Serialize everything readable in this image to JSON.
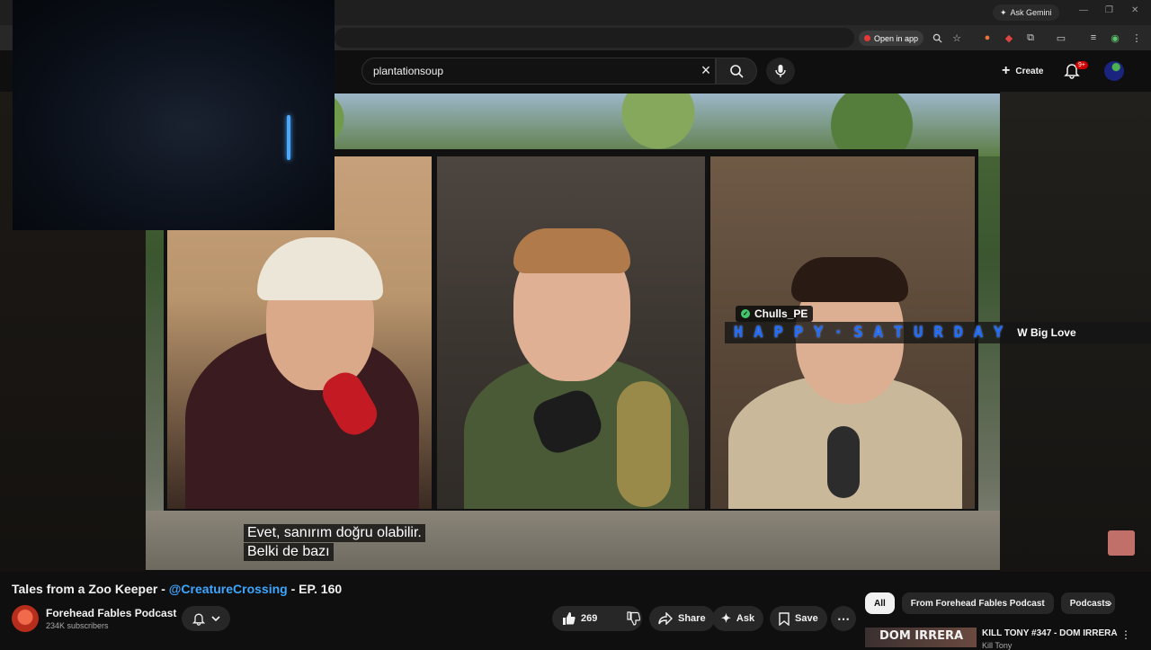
{
  "browser": {
    "ask_gemini": "Ask Gemini",
    "open_in_app": "Open in app",
    "window_min": "—",
    "window_restore": "❐",
    "window_close": "✕"
  },
  "header": {
    "search_value": "plantationsoup",
    "create_label": "Create",
    "notif_badge": "9+"
  },
  "video": {
    "chat_username": "Chulls_PE",
    "chat_message": "HAPPY·SATURDAY",
    "chat_tail": "W Big Love",
    "caption_line1": "Evet, sanırım doğru olabilir.",
    "caption_line2": "Belki de bazı"
  },
  "meta": {
    "title_prefix": "Tales from a Zoo Keeper - ",
    "title_handle": "@CreatureCrossing",
    "title_suffix": " - EP. 160",
    "channel_name": "Forehead Fables Podcast",
    "subscribers": "234K subscribers"
  },
  "actions": {
    "like_count": "269",
    "share": "Share",
    "ask": "Ask",
    "save": "Save"
  },
  "chips": [
    "All",
    "From Forehead Fables Podcast",
    "Podcasts"
  ],
  "recommended": {
    "thumb_text": "DOM IRRERA",
    "title": "KILL TONY #347 - DOM IRRERA",
    "channel": "Kill Tony"
  },
  "colors": {
    "accent_link": "#3ea6ff",
    "chat_text": "#1e6bff",
    "notif_red": "#cc0000"
  }
}
